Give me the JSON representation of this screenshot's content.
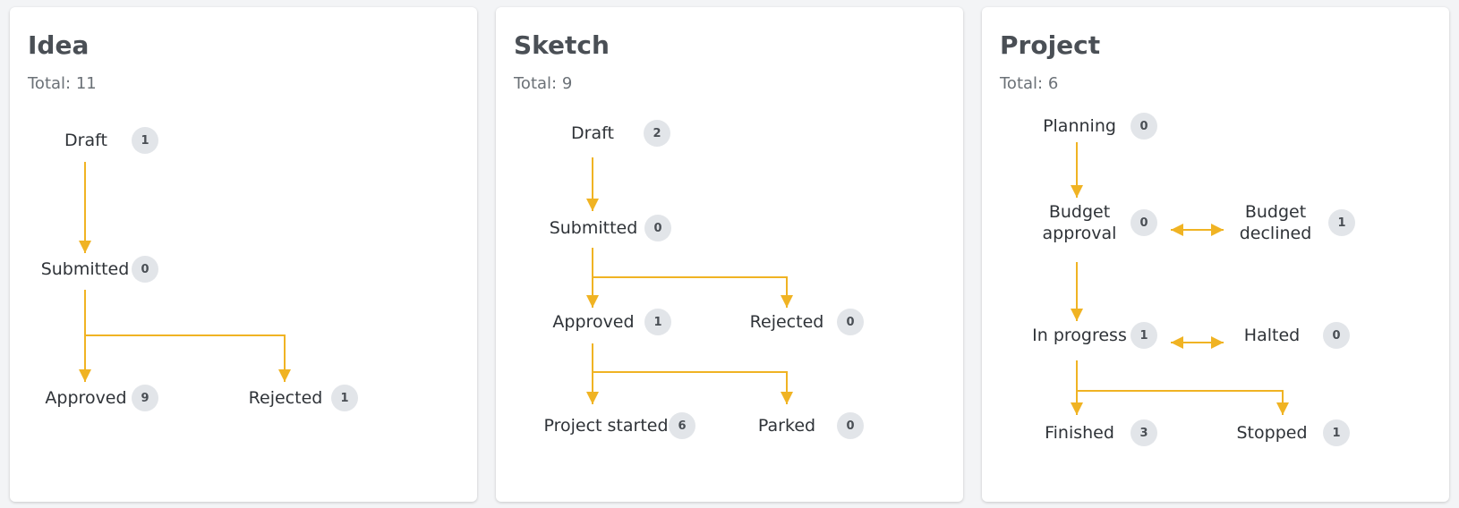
{
  "accent_color": "#f0b323",
  "cards": [
    {
      "title": "Idea",
      "total_label": "Total:",
      "total_value": "11",
      "nodes": [
        {
          "label": "Draft",
          "count": "1"
        },
        {
          "label": "Submitted",
          "count": "0"
        },
        {
          "label": "Approved",
          "count": "9"
        },
        {
          "label": "Rejected",
          "count": "1"
        }
      ]
    },
    {
      "title": "Sketch",
      "total_label": "Total:",
      "total_value": "9",
      "nodes": [
        {
          "label": "Draft",
          "count": "2"
        },
        {
          "label": "Submitted",
          "count": "0"
        },
        {
          "label": "Approved",
          "count": "1"
        },
        {
          "label": "Rejected",
          "count": "0"
        },
        {
          "label": "Project started",
          "count": "6"
        },
        {
          "label": "Parked",
          "count": "0"
        }
      ]
    },
    {
      "title": "Project",
      "total_label": "Total:",
      "total_value": "6",
      "nodes": [
        {
          "label": "Planning",
          "count": "0"
        },
        {
          "label": "Budget approval",
          "count": "0"
        },
        {
          "label": "Budget declined",
          "count": "1"
        },
        {
          "label": "In progress",
          "count": "1"
        },
        {
          "label": "Halted",
          "count": "0"
        },
        {
          "label": "Finished",
          "count": "3"
        },
        {
          "label": "Stopped",
          "count": "1"
        }
      ]
    }
  ]
}
